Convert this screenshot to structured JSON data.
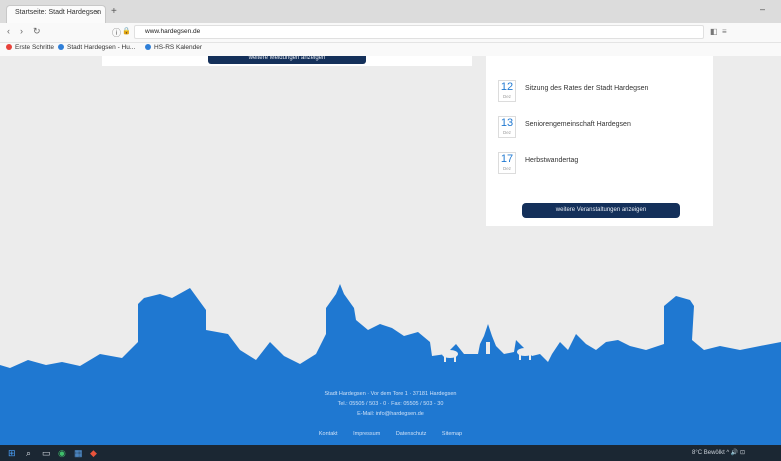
{
  "browser": {
    "tab_title": "Startseite: Stadt Hardegsen",
    "tab_close": "×",
    "new_tab": "+",
    "window_minimize": "–",
    "url_host": "www.hardegsen.de",
    "nav": {
      "back": "‹",
      "forward": "›",
      "reload": "↻",
      "info": "ⓘ",
      "lock": "🔒"
    },
    "bookmarks": [
      {
        "label": "Erste Schritte",
        "color": "#e8423a"
      },
      {
        "label": "Stadt Hardegsen - Hu...",
        "color": "#2f7fd8"
      },
      {
        "label": "HS-RS Kalender",
        "color": "#2f7fd8"
      }
    ]
  },
  "page": {
    "colors": {
      "brand_blue": "#1f78d1",
      "button_dark": "#14305a"
    },
    "left_button": "weitere Meldungen anzeigen",
    "events": [
      {
        "day": "12",
        "month": "Dez",
        "title": "Sitzung des Rates der Stadt Hardegsen"
      },
      {
        "day": "13",
        "month": "Dez",
        "title": "Seniorengemeinschaft Hardegsen"
      },
      {
        "day": "17",
        "month": "Dez",
        "title": "Herbstwandertag"
      }
    ],
    "right_button": "weitere Veranstaltungen anzeigen",
    "footer": {
      "address": "Stadt Hardegsen · Vor dem Tore 1 · 37181 Hardegsen",
      "phone": "Tel.: 05505 / 503 - 0 · Fax: 05505 / 503 - 30",
      "email": "E-Mail: info@hardegsen.de",
      "links": [
        "Kontakt",
        "Impressum",
        "Datenschutz",
        "Sitemap"
      ]
    }
  },
  "taskbar": {
    "start": "⊞",
    "items": [
      "⌕",
      "▭",
      "◉",
      "▦",
      "◆"
    ],
    "tray_text": "8°C Bewölkt ^ 🔊 ⊡",
    "tray_weather_icon": "cloud-icon"
  }
}
